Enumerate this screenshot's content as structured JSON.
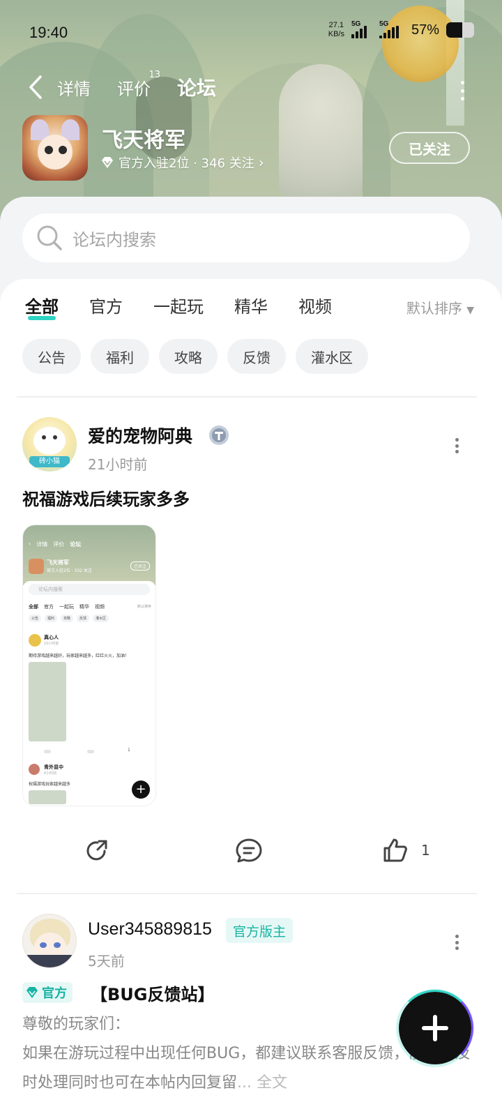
{
  "status_bar": {
    "time": "19:40",
    "net_speed_value": "27.1",
    "net_speed_unit": "KB/s",
    "sim1_tag": "5G",
    "sim2_tag": "5G",
    "battery_pct": "57%",
    "battery_level": 0.57
  },
  "top_nav": {
    "tabs": [
      {
        "label": "详情"
      },
      {
        "label": "评价",
        "count": "13"
      },
      {
        "label": "论坛"
      }
    ],
    "active_tab": "论坛"
  },
  "game": {
    "title": "飞天将军",
    "meta": "官方入驻2位 · 346 关注",
    "follow_label": "已关注"
  },
  "search": {
    "placeholder": "论坛内搜索"
  },
  "category_tabs": [
    "全部",
    "官方",
    "一起玩",
    "精华",
    "视频"
  ],
  "active_category": "全部",
  "sort_label": "默认排序",
  "chips": [
    "公告",
    "福利",
    "攻略",
    "反馈",
    "灌水区"
  ],
  "posts": [
    {
      "author": "爱的宠物阿典",
      "time": "21小时前",
      "title": "祝福游戏后续玩家多多",
      "avatar_badge": "砖小猫",
      "likes": "1"
    },
    {
      "author": "User345889815",
      "badge": "官方版主",
      "time": "5天前",
      "official_tag": "官方",
      "title": "【BUG反馈站】",
      "greeting": "尊敬的玩家们：",
      "body": " 如果在游玩过程中出现任何BUG，都建议联系客服反馈，能为您及时处理同时也可在本帖内回复留",
      "more_label": "... 全文"
    }
  ],
  "thumbnail": {
    "tabs": [
      "详情",
      "评价",
      "论坛"
    ],
    "title": "飞天将军",
    "meta": "官方入驻2位 · 332 关注",
    "follow": "已关注",
    "search": "论坛内搜索",
    "cats": [
      "全部",
      "官方",
      "一起玩",
      "精华",
      "视频"
    ],
    "sort": "默认排序",
    "chips": [
      "公告",
      "福利",
      "攻略",
      "反馈",
      "灌水区"
    ],
    "post1_author": "真心人",
    "post1_time": "10小时前",
    "post1_text": "期待游戏越来越好，玩家越来越多，红红火火，加油！",
    "post1_likes": "1",
    "post2_author": "青外显中",
    "post2_time": "6小时前",
    "post2_text": "祝福游戏玩家越来越多"
  },
  "colors": {
    "accent": "#2fd3c3",
    "mod_badge_bg": "#e6f8f6",
    "mod_badge_text": "#17b3a3"
  }
}
